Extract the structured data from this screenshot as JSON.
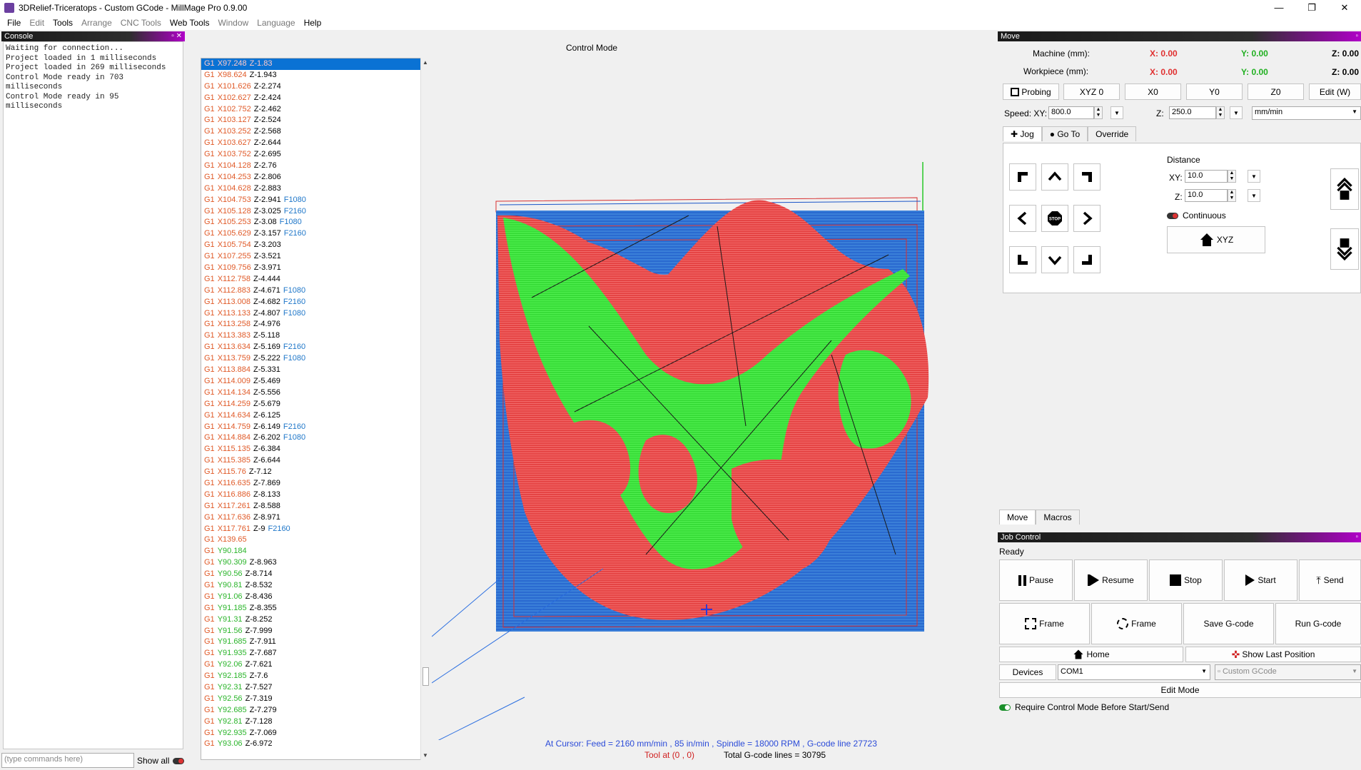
{
  "window": {
    "title": "3DRelief-Triceratops - Custom GCode - MillMage Pro 0.9.00"
  },
  "menu": [
    "File",
    "Edit",
    "Tools",
    "Arrange",
    "CNC Tools",
    "Web Tools",
    "Window",
    "Language",
    "Help"
  ],
  "console": {
    "title": "Console",
    "lines": [
      "Waiting for connection...",
      "Project loaded in 1 milliseconds",
      "Project loaded in 269 milliseconds",
      "Control Mode ready in 703",
      "milliseconds",
      "Control Mode ready in 95",
      "milliseconds"
    ],
    "input_placeholder": "(type commands here)",
    "show_all": "Show all"
  },
  "gcode_lines": [
    [
      "G1",
      "X97.248",
      "Z-1.83",
      ""
    ],
    [
      "G1",
      "X98.624",
      "Z-1.943",
      ""
    ],
    [
      "G1",
      "X101.626",
      "Z-2.274",
      ""
    ],
    [
      "G1",
      "X102.627",
      "Z-2.424",
      ""
    ],
    [
      "G1",
      "X102.752",
      "Z-2.462",
      ""
    ],
    [
      "G1",
      "X103.127",
      "Z-2.524",
      ""
    ],
    [
      "G1",
      "X103.252",
      "Z-2.568",
      ""
    ],
    [
      "G1",
      "X103.627",
      "Z-2.644",
      ""
    ],
    [
      "G1",
      "X103.752",
      "Z-2.695",
      ""
    ],
    [
      "G1",
      "X104.128",
      "Z-2.76",
      ""
    ],
    [
      "G1",
      "X104.253",
      "Z-2.806",
      ""
    ],
    [
      "G1",
      "X104.628",
      "Z-2.883",
      ""
    ],
    [
      "G1",
      "X104.753",
      "Z-2.941",
      "F1080"
    ],
    [
      "G1",
      "X105.128",
      "Z-3.025",
      "F2160"
    ],
    [
      "G1",
      "X105.253",
      "Z-3.08",
      "F1080"
    ],
    [
      "G1",
      "X105.629",
      "Z-3.157",
      "F2160"
    ],
    [
      "G1",
      "X105.754",
      "Z-3.203",
      ""
    ],
    [
      "G1",
      "X107.255",
      "Z-3.521",
      ""
    ],
    [
      "G1",
      "X109.756",
      "Z-3.971",
      ""
    ],
    [
      "G1",
      "X112.758",
      "Z-4.444",
      ""
    ],
    [
      "G1",
      "X112.883",
      "Z-4.671",
      "F1080"
    ],
    [
      "G1",
      "X113.008",
      "Z-4.682",
      "F2160"
    ],
    [
      "G1",
      "X113.133",
      "Z-4.807",
      "F1080"
    ],
    [
      "G1",
      "X113.258",
      "Z-4.976",
      ""
    ],
    [
      "G1",
      "X113.383",
      "Z-5.118",
      ""
    ],
    [
      "G1",
      "X113.634",
      "Z-5.169",
      "F2160"
    ],
    [
      "G1",
      "X113.759",
      "Z-5.222",
      "F1080"
    ],
    [
      "G1",
      "X113.884",
      "Z-5.331",
      ""
    ],
    [
      "G1",
      "X114.009",
      "Z-5.469",
      ""
    ],
    [
      "G1",
      "X114.134",
      "Z-5.556",
      ""
    ],
    [
      "G1",
      "X114.259",
      "Z-5.679",
      ""
    ],
    [
      "G1",
      "X114.634",
      "Z-6.125",
      ""
    ],
    [
      "G1",
      "X114.759",
      "Z-6.149",
      "F2160"
    ],
    [
      "G1",
      "X114.884",
      "Z-6.202",
      "F1080"
    ],
    [
      "G1",
      "X115.135",
      "Z-6.384",
      ""
    ],
    [
      "G1",
      "X115.385",
      "Z-6.644",
      ""
    ],
    [
      "G1",
      "X115.76",
      "Z-7.12",
      ""
    ],
    [
      "G1",
      "X116.635",
      "Z-7.869",
      ""
    ],
    [
      "G1",
      "X116.886",
      "Z-8.133",
      ""
    ],
    [
      "G1",
      "X117.261",
      "Z-8.588",
      ""
    ],
    [
      "G1",
      "X117.636",
      "Z-8.971",
      ""
    ],
    [
      "G1",
      "X117.761",
      "Z-9",
      "F2160"
    ],
    [
      "G1",
      "X139.65",
      "",
      ""
    ],
    [
      "G1",
      "Y90.184",
      "",
      ""
    ],
    [
      "G1",
      "Y90.309",
      "Z-8.963",
      ""
    ],
    [
      "G1",
      "Y90.56",
      "Z-8.714",
      ""
    ],
    [
      "G1",
      "Y90.81",
      "Z-8.532",
      ""
    ],
    [
      "G1",
      "Y91.06",
      "Z-8.436",
      ""
    ],
    [
      "G1",
      "Y91.185",
      "Z-8.355",
      ""
    ],
    [
      "G1",
      "Y91.31",
      "Z-8.252",
      ""
    ],
    [
      "G1",
      "Y91.56",
      "Z-7.999",
      ""
    ],
    [
      "G1",
      "Y91.685",
      "Z-7.911",
      ""
    ],
    [
      "G1",
      "Y91.935",
      "Z-7.687",
      ""
    ],
    [
      "G1",
      "Y92.06",
      "Z-7.621",
      ""
    ],
    [
      "G1",
      "Y92.185",
      "Z-7.6",
      ""
    ],
    [
      "G1",
      "Y92.31",
      "Z-7.527",
      ""
    ],
    [
      "G1",
      "Y92.56",
      "Z-7.319",
      ""
    ],
    [
      "G1",
      "Y92.685",
      "Z-7.279",
      ""
    ],
    [
      "G1",
      "Y92.81",
      "Z-7.128",
      ""
    ],
    [
      "G1",
      "Y92.935",
      "Z-7.069",
      ""
    ],
    [
      "G1",
      "Y93.06",
      "Z-6.972",
      ""
    ]
  ],
  "viewport": {
    "title": "Control Mode",
    "cursor_status": "At Cursor: Feed = 2160 mm/min , 85 in/min , Spindle = 18000 RPM , G-code line 27723",
    "tool_at": "Tool at (0 , 0)",
    "total_lines": "Total G-code lines = 30795"
  },
  "move": {
    "title": "Move",
    "machine_label": "Machine (mm):",
    "workpiece_label": "Workpiece (mm):",
    "machine": {
      "x": "X: 0.00",
      "y": "Y: 0.00",
      "z": "Z: 0.00"
    },
    "workpiece": {
      "x": "X: 0.00",
      "y": "Y: 0.00",
      "z": "Z: 0.00"
    },
    "buttons": [
      "Probing",
      "XYZ 0",
      "X0",
      "Y0",
      "Z0",
      "Edit (W)"
    ],
    "speed_xy_label": "Speed: XY:",
    "speed_xy": "800.0",
    "z_label": "Z:",
    "speed_z": "250.0",
    "units": "mm/min",
    "tabs": [
      "Jog",
      "Go To",
      "Override"
    ],
    "distance_label": "Distance",
    "xy_label": "XY:",
    "xy_dist": "10.0",
    "zdist_label": "Z:",
    "z_dist": "10.0",
    "continuous": "Continuous",
    "home_xyz": "XYZ",
    "stop": "STOP"
  },
  "bottom_tabs": [
    "Move",
    "Macros"
  ],
  "job": {
    "title": "Job Control",
    "status": "Ready",
    "row1": [
      "Pause",
      "Resume",
      "Stop",
      "Start",
      "Send"
    ],
    "row2": [
      "Frame",
      "Frame",
      "Save G-code",
      "Run G-code"
    ],
    "home": "Home",
    "show_last": "Show Last Position",
    "devices": "Devices",
    "port": "COM1",
    "profile": "Custom GCode",
    "edit_mode": "Edit Mode",
    "require": "Require Control Mode Before Start/Send"
  }
}
